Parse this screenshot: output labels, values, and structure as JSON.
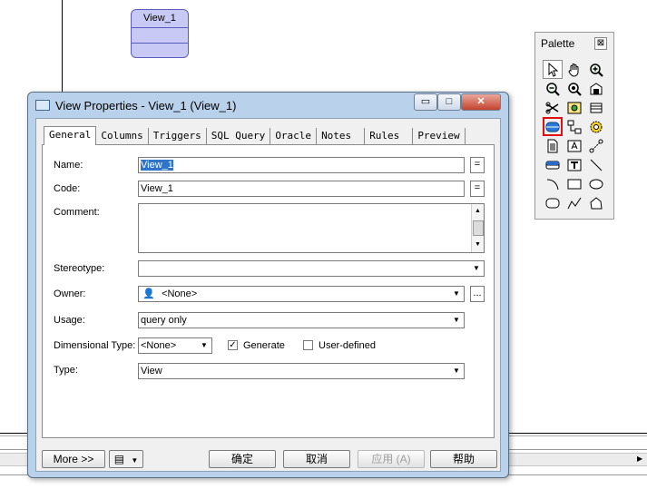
{
  "canvas": {
    "view_symbol_title": "View_1"
  },
  "palette": {
    "title": "Palette",
    "close_label": "⊠",
    "tools": [
      {
        "icon": "pointer-icon"
      },
      {
        "icon": "hand-icon"
      },
      {
        "icon": "zoom-in-icon"
      },
      {
        "icon": "zoom-out-icon"
      },
      {
        "icon": "zoom-fit-icon"
      },
      {
        "icon": "open-package-icon"
      },
      {
        "icon": "cut-icon"
      },
      {
        "icon": "properties-icon"
      },
      {
        "icon": "table-icon"
      },
      {
        "icon": "view-icon",
        "selected": true
      },
      {
        "icon": "reference-icon"
      },
      {
        "icon": "procedure-icon"
      },
      {
        "icon": "file-icon"
      },
      {
        "icon": "text-icon"
      },
      {
        "icon": "link-icon"
      },
      {
        "icon": "package-icon"
      },
      {
        "icon": "title-icon"
      },
      {
        "icon": "line-icon"
      },
      {
        "icon": "arc-icon"
      },
      {
        "icon": "rectangle-icon"
      },
      {
        "icon": "ellipse-icon"
      },
      {
        "icon": "rounded-rectangle-icon"
      },
      {
        "icon": "polyline-icon"
      },
      {
        "icon": "polygon-icon"
      }
    ]
  },
  "dialog": {
    "title": "View Properties - View_1 (View_1)",
    "window_buttons": {
      "minimize": "▭",
      "maximize": "□",
      "close": "✕"
    },
    "tabs": [
      "General",
      "Columns",
      "Triggers",
      "SQL Query",
      "Oracle",
      "Notes",
      "Rules",
      "Preview"
    ],
    "active_tab": "General",
    "fields": {
      "name": {
        "label": "Name:",
        "value": "View_1",
        "button": "="
      },
      "code": {
        "label": "Code:",
        "value": "View_1",
        "button": "="
      },
      "comment": {
        "label": "Comment:",
        "value": ""
      },
      "stereotype": {
        "label": "Stereotype:",
        "value": ""
      },
      "owner": {
        "label": "Owner:",
        "value": "<None>",
        "button": "..."
      },
      "usage": {
        "label": "Usage:",
        "value": "query only"
      },
      "dimensional_type": {
        "label": "Dimensional Type:",
        "value": "<None>"
      },
      "generate": {
        "label": "Generate",
        "checked": true
      },
      "user_defined": {
        "label": "User-defined",
        "checked": false
      },
      "type": {
        "label": "Type:",
        "value": "View"
      }
    },
    "footer": {
      "more": "More >>",
      "ok": "确定",
      "cancel": "取消",
      "apply": "应用 (A)",
      "help": "帮助"
    }
  }
}
